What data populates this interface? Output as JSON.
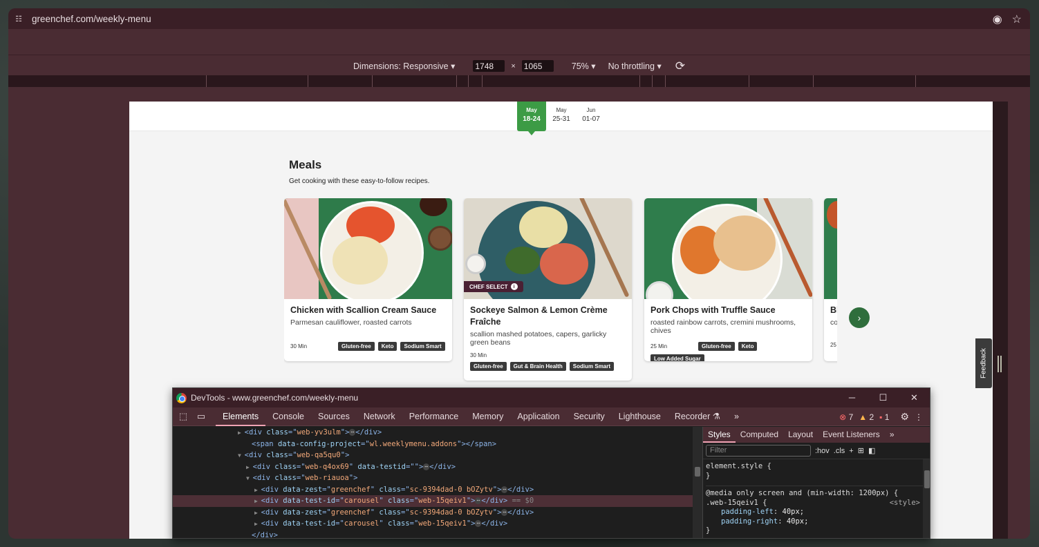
{
  "browser": {
    "url": "greenchef.com/weekly-menu"
  },
  "device_toolbar": {
    "dimensions_label": "Dimensions: Responsive",
    "width": "1748",
    "height": "1065",
    "times": "×",
    "zoom": "75%",
    "throttling": "No throttling"
  },
  "page": {
    "weeks": [
      {
        "month": "May",
        "range": "18-24",
        "active": true
      },
      {
        "month": "May",
        "range": "25-31",
        "active": false
      },
      {
        "month": "Jun",
        "range": "01-07",
        "active": false
      }
    ],
    "meals_title": "Meals",
    "meals_subtitle": "Get cooking with these easy-to-follow recipes.",
    "cards": [
      {
        "name": "Chicken with Scallion Cream Sauce",
        "description": "Parmesan cauliflower, roasted carrots",
        "time": "30 Min",
        "tags": [
          "Gluten-free",
          "Keto",
          "Sodium Smart"
        ],
        "badge": ""
      },
      {
        "name": "Sockeye Salmon & Lemon Crème Fraîche",
        "description": "scallion mashed potatoes, capers, garlicky green beans",
        "time": "30 Min",
        "tags": [
          "Gluten-free",
          "Gut & Brain Health",
          "Sodium Smart"
        ],
        "badge": "CHEF SELECT"
      },
      {
        "name": "Pork Chops with Truffle Sauce",
        "description": "roasted rainbow carrots, cremini mushrooms, chives",
        "time": "25 Min",
        "tags": [
          "Gluten-free",
          "Keto",
          "Low Added Sugar"
        ],
        "badge": ""
      },
      {
        "name": "Bl",
        "description": "co",
        "time": "25",
        "tags": [],
        "badge": ""
      }
    ],
    "feedback_label": "Feedback"
  },
  "devtools": {
    "title": "DevTools - www.greenchef.com/weekly-menu",
    "tabs": [
      "Elements",
      "Console",
      "Sources",
      "Network",
      "Performance",
      "Memory",
      "Application",
      "Security",
      "Lighthouse",
      "Recorder"
    ],
    "active_tab": "Elements",
    "errors": "7",
    "warnings": "2",
    "issues": "1",
    "styles_tabs": [
      "Styles",
      "Computed",
      "Layout",
      "Event Listeners"
    ],
    "filter_placeholder": "Filter",
    "hov_label": ":hov",
    "cls_label": ".cls",
    "dom_lines": [
      {
        "indent": 8,
        "arrow": "▶",
        "tag": "div",
        "attrs": [
          [
            "class",
            "web-yv3ulm"
          ]
        ],
        "ellipsis": true,
        "close": "</div>",
        "selected": false
      },
      {
        "indent": 9,
        "arrow": "",
        "tag": "span",
        "attrs": [
          [
            "data-config-project",
            "wl.weeklymenu.addons"
          ]
        ],
        "ellipsis": false,
        "close": "</span>",
        "selected": false
      },
      {
        "indent": 8,
        "arrow": "▼",
        "tag": "div",
        "attrs": [
          [
            "class",
            "web-qa5qu0"
          ]
        ],
        "ellipsis": false,
        "close": "",
        "selected": false
      },
      {
        "indent": 9,
        "arrow": "▶",
        "tag": "div",
        "attrs": [
          [
            "class",
            "web-q4ox69"
          ],
          [
            "data-testid",
            ""
          ]
        ],
        "ellipsis": true,
        "close": "</div>",
        "selected": false
      },
      {
        "indent": 9,
        "arrow": "▼",
        "tag": "div",
        "attrs": [
          [
            "class",
            "web-riauoa"
          ]
        ],
        "ellipsis": false,
        "close": "",
        "selected": false
      },
      {
        "indent": 10,
        "arrow": "▶",
        "tag": "div",
        "attrs": [
          [
            "data-zest",
            "greenchef"
          ],
          [
            "class",
            "sc-9394dad-0 bOZytv"
          ]
        ],
        "ellipsis": true,
        "close": "</div>",
        "selected": false
      },
      {
        "indent": 10,
        "arrow": "▶",
        "tag": "div",
        "attrs": [
          [
            "data-test-id",
            "carousel"
          ],
          [
            "class",
            "web-15qeiv1"
          ]
        ],
        "ellipsis": true,
        "close": "</div> == $0",
        "selected": true
      },
      {
        "indent": 10,
        "arrow": "▶",
        "tag": "div",
        "attrs": [
          [
            "data-zest",
            "greenchef"
          ],
          [
            "class",
            "sc-9394dad-0 bOZytv"
          ]
        ],
        "ellipsis": true,
        "close": "</div>",
        "selected": false
      },
      {
        "indent": 10,
        "arrow": "▶",
        "tag": "div",
        "attrs": [
          [
            "data-test-id",
            "carousel"
          ],
          [
            "class",
            "web-15qeiv1"
          ]
        ],
        "ellipsis": true,
        "close": "</div>",
        "selected": false
      },
      {
        "indent": 9,
        "arrow": "",
        "tag": "",
        "attrs": [],
        "ellipsis": false,
        "close": "</div>",
        "selected": false
      }
    ],
    "styles_lines": {
      "element_style": "element.style {",
      "element_close": "}",
      "media": "@media only screen and (min-width: 1200px) {",
      "selector": ".web-15qeiv1 {",
      "source": "<style>",
      "props": [
        {
          "name": "padding-left",
          "value": "40px;"
        },
        {
          "name": "padding-right",
          "value": "40px;"
        }
      ],
      "rule_close": "}"
    }
  }
}
